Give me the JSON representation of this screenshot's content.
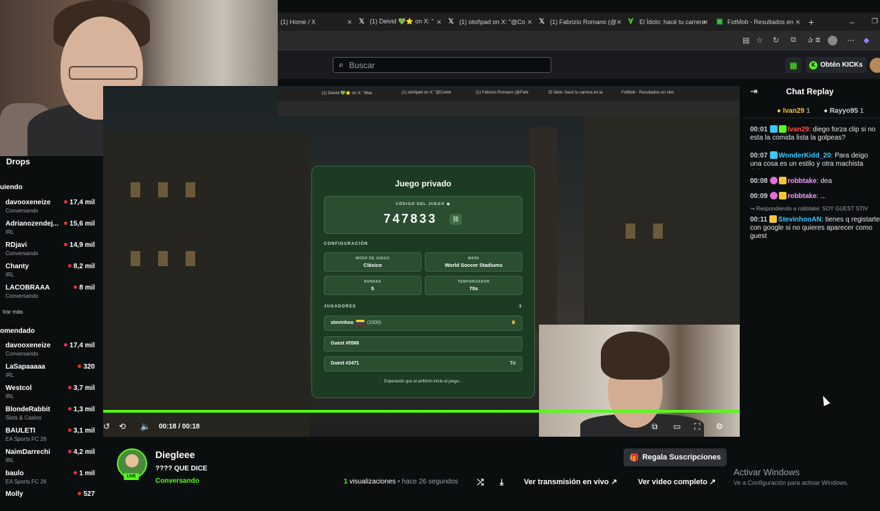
{
  "browser": {
    "tabs": [
      {
        "label": "(1) Home / X",
        "icon": "x-icon"
      },
      {
        "label": "(1) Deivid 💚⭐ on X: \"",
        "icon": "x-icon"
      },
      {
        "label": "(1) otoñpad on X: \"@Co",
        "icon": "x-icon"
      },
      {
        "label": "(1) Fabrizio Romano (@",
        "icon": "x-icon"
      },
      {
        "label": "El Ídolo: hacé tu carrera",
        "icon": "idolo-icon"
      },
      {
        "label": "FotMob - Resultados en",
        "icon": "fotmob-icon"
      }
    ],
    "new_tab_glyph": "+"
  },
  "header": {
    "search_placeholder": "Buscar",
    "kicks_label": "Obtén KICKs",
    "kicks_glyph": "K"
  },
  "sidebar": {
    "drops_label": "Drops",
    "following_title": "uiendo",
    "following": [
      {
        "name": "davooxeneize",
        "category": "Conversando",
        "viewers": "17,4 mil"
      },
      {
        "name": "Adrianozendej...",
        "category": "IRL",
        "viewers": "15,6 mil"
      },
      {
        "name": "RDjavi",
        "category": "Conversando",
        "viewers": "14,9 mil"
      },
      {
        "name": "Chanty",
        "category": "IRL",
        "viewers": "8,2 mil"
      },
      {
        "name": "LACOBRAAA",
        "category": "Conversando",
        "viewers": "8 mil"
      }
    ],
    "show_more": "trar más",
    "recommended_title": "omendado",
    "recommended": [
      {
        "name": "davooxeneize",
        "category": "Conversando",
        "viewers": "17,4 mil"
      },
      {
        "name": "LaSapaaaaa",
        "category": "IRL",
        "viewers": "320"
      },
      {
        "name": "Westcol",
        "category": "IRL",
        "viewers": "3,7 mil"
      },
      {
        "name": "BlondeRabbit",
        "category": "Slots & Casino",
        "viewers": "1,3 mil"
      },
      {
        "name": "BAULETI",
        "category": "EA Sports FC 26",
        "viewers": "3,1 mil"
      },
      {
        "name": "NaimDarrechi",
        "category": "IRL",
        "viewers": "4,2 mil"
      },
      {
        "name": "baulo",
        "category": "EA Sports FC 26",
        "viewers": "1 mil"
      },
      {
        "name": "Molly",
        "category": "",
        "viewers": "527"
      }
    ]
  },
  "inner_browser": {
    "tabs": [
      "(1) Deivid 💚⭐ on X: \"Was",
      "(1) otoñpad on X: \"@Conte",
      "(1) Fabrizio Romano (@Fabr",
      "El Ídolo: hacé tu carrera en la",
      "FotMob - Resultados en vivo"
    ]
  },
  "game": {
    "title": "Juego privado",
    "code_label": "CÓDIGO DEL JUEGO",
    "code": "747833",
    "config_label": "CONFIGURACIÓN",
    "config": [
      {
        "label": "MODO DE JUEGO",
        "value": "Clásico"
      },
      {
        "label": "MAPA",
        "value": "World Soccer Stadiums"
      },
      {
        "label": "RONDAS",
        "value": "5"
      },
      {
        "label": "TEMPORIZADOR",
        "value": "70s"
      }
    ],
    "players_label": "JUGADORES",
    "players_count": "3",
    "players": [
      {
        "name": "stevinhoo",
        "elo": "(1000)",
        "marker": "♛"
      },
      {
        "name": "Guest #5566",
        "elo": "",
        "marker": ""
      },
      {
        "name": "Guest #3471",
        "elo": "",
        "marker": "Tú"
      }
    ],
    "waiting": "Esperando que el anfitrión inicie el juego..."
  },
  "player": {
    "time": "00:18 / 00:18",
    "progress": 1.0,
    "accent": "#53fc18"
  },
  "stream": {
    "streamer": "Diegleee",
    "live": "LIVE",
    "title": "???? QUE DICE",
    "category": "Conversando",
    "views_count": "1",
    "views_word": "visualizaciones",
    "ago": "• hace 26 segundos",
    "live_btn": "Ver transmisión en vivo",
    "full_btn": "Ver video completo",
    "gift_btn": "Regala Suscripciones"
  },
  "chat": {
    "title": "Chat Replay",
    "pinned": [
      {
        "name": "Ivan29",
        "count": "1"
      },
      {
        "name": "Rayyo95",
        "count": "1"
      }
    ],
    "messages": [
      {
        "time": "00:01",
        "user": "Ivan29",
        "color": "#ff4d4d",
        "text": "diego forza clip si no esta la comida lista la golpeas?"
      },
      {
        "time": "00:07",
        "user": "WonderKidd_20",
        "color": "#39c9ff",
        "text": "Para deigo una cosa es un estilo y otra machista deigo pa"
      },
      {
        "time": "00:08",
        "user": "robbtake",
        "color": "#f29bff",
        "text": "dea"
      },
      {
        "time": "00:09",
        "user": "robbtake",
        "color": "#f29bff",
        "text": "..."
      },
      {
        "time": "00:11",
        "user": "StevinhooAN",
        "color": "#39c9ff",
        "text": "tienes q registarte con google si no quieres aparecer como guest"
      }
    ],
    "replying": "↪ Respondiendo a robbtake: SOY GUEST STIV"
  },
  "windows": {
    "activate": "Activar Windows",
    "activate_sub": "Ve a Configuración para activar Windows."
  }
}
